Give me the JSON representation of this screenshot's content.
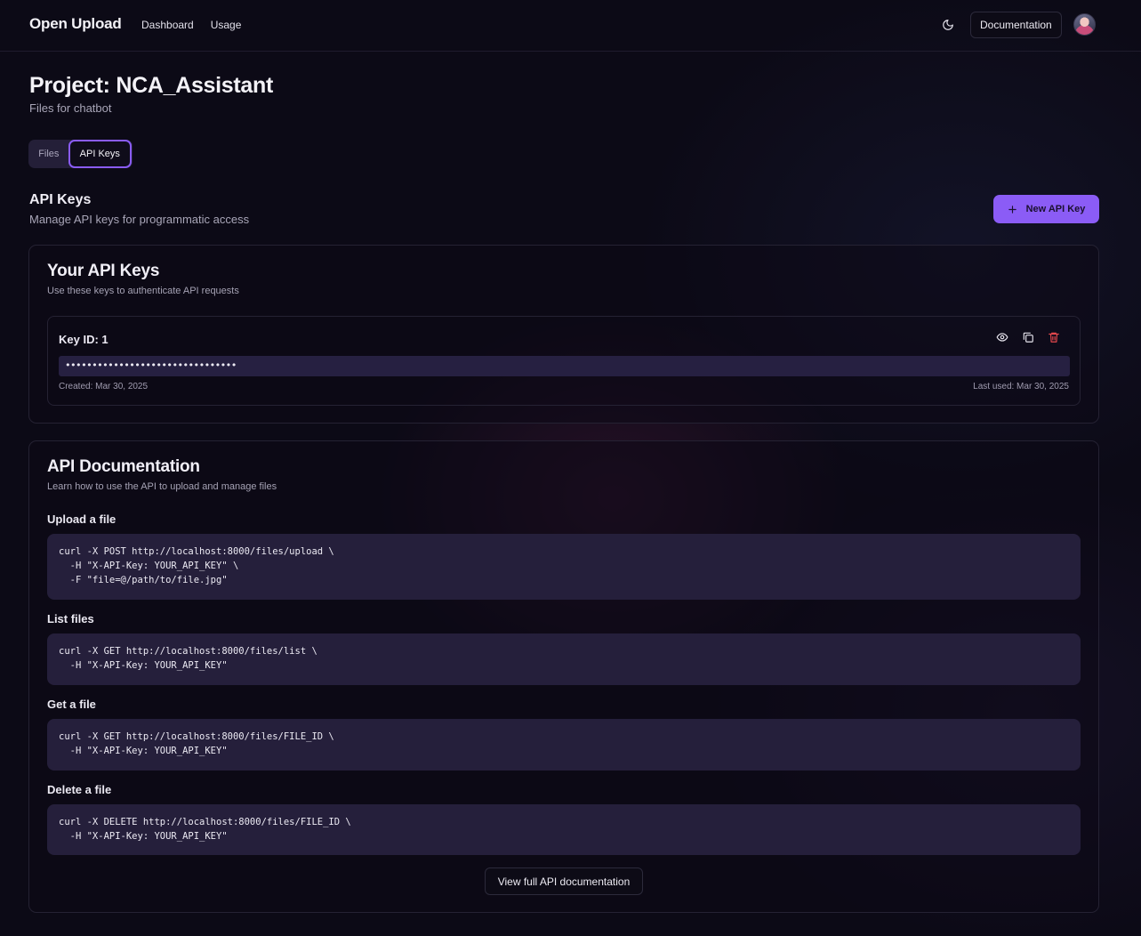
{
  "header": {
    "brand": "Open Upload",
    "nav": [
      "Dashboard",
      "Usage"
    ],
    "documentation_label": "Documentation",
    "theme_icon": "moon-icon",
    "avatar_icon": "user-avatar"
  },
  "project": {
    "title": "Project: NCA_Assistant",
    "subtitle": "Files for chatbot"
  },
  "tabs": [
    {
      "label": "Files",
      "active": false
    },
    {
      "label": "API Keys",
      "active": true
    }
  ],
  "api_keys_section": {
    "title": "API Keys",
    "subtitle": "Manage API keys for programmatic access",
    "new_key_label": "New API Key",
    "new_key_icon": "plus-icon"
  },
  "keys_card": {
    "title": "Your API Keys",
    "subtitle": "Use these keys to authenticate API requests",
    "keys": [
      {
        "id_label": "Key ID: 1",
        "masked_value": "••••••••••••••••••••••••••••••••",
        "created": "Created: Mar 30, 2025",
        "last_used": "Last used: Mar 30, 2025",
        "actions": [
          "eye-icon",
          "copy-icon",
          "trash-icon"
        ]
      }
    ]
  },
  "docs_card": {
    "title": "API Documentation",
    "subtitle": "Learn how to use the API to upload and manage files",
    "sections": [
      {
        "label": "Upload a file",
        "code": "curl -X POST http://localhost:8000/files/upload \\\n  -H \"X-API-Key: YOUR_API_KEY\" \\\n  -F \"file=@/path/to/file.jpg\""
      },
      {
        "label": "List files",
        "code": "curl -X GET http://localhost:8000/files/list \\\n  -H \"X-API-Key: YOUR_API_KEY\""
      },
      {
        "label": "Get a file",
        "code": "curl -X GET http://localhost:8000/files/FILE_ID \\\n  -H \"X-API-Key: YOUR_API_KEY\""
      },
      {
        "label": "Delete a file",
        "code": "curl -X DELETE http://localhost:8000/files/FILE_ID \\\n  -H \"X-API-Key: YOUR_API_KEY\""
      }
    ],
    "view_full_label": "View full API documentation"
  },
  "colors": {
    "background": "#0c0a16",
    "accent": "#8b5cf6",
    "danger": "#e5484d"
  }
}
